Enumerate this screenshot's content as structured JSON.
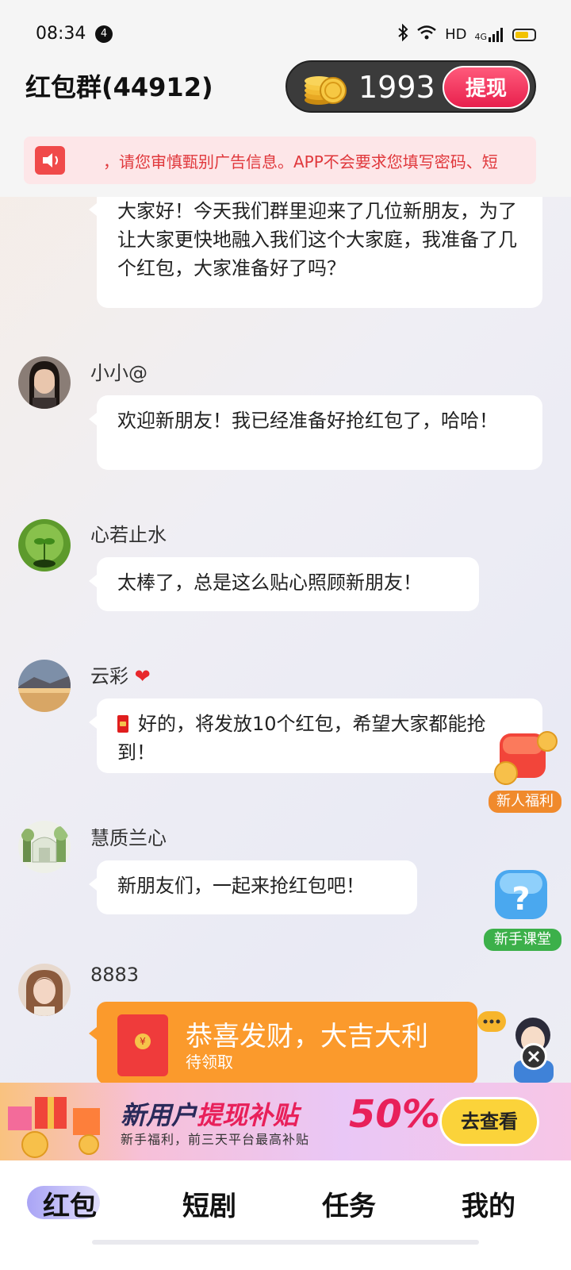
{
  "status_bar": {
    "time": "08:34",
    "notification_count": "4",
    "network": "HD",
    "signal_type": "4G"
  },
  "header": {
    "group_title": "红包群(44912)",
    "coin_balance": "1993",
    "withdraw_label": "提现",
    "notice_text": "，请您审慎甄别广告信息。APP不会要求您填写密码、短"
  },
  "messages": [
    {
      "text": "大家好！今天我们群里迎来了几位新朋友，为了让大家更快地融入我们这个大家庭，我准备了几个红包，大家准备好了吗？"
    },
    {
      "name": "小小@",
      "text": "欢迎新朋友！我已经准备好抢红包了，哈哈！"
    },
    {
      "name": "心若止水",
      "text": "太棒了，总是这么贴心照顾新朋友！"
    },
    {
      "name": "云彩",
      "text": "好的，将发放10个红包，希望大家都能抢到！"
    },
    {
      "name": "慧质兰心",
      "text": "新朋友们，一起来抢红包吧！"
    },
    {
      "name": "8883"
    }
  ],
  "red_packet": {
    "title": "恭喜发财，大吉大利",
    "status": "待领取"
  },
  "floating": {
    "newbie_welfare": "新人福利",
    "tutorial": "新手课堂"
  },
  "banner": {
    "title_part1": "新用户",
    "title_part2": "提现补贴",
    "percent": "50%",
    "subtitle": "新手福利，前三天平台最高补贴",
    "button": "去查看"
  },
  "nav": {
    "items": [
      "红包",
      "短剧",
      "任务",
      "我的"
    ],
    "active": "红包"
  },
  "colors": {
    "accent_red": "#e8205a",
    "red_packet_orange": "#fb9a2c",
    "coin_pill": "#3b3b3b"
  }
}
